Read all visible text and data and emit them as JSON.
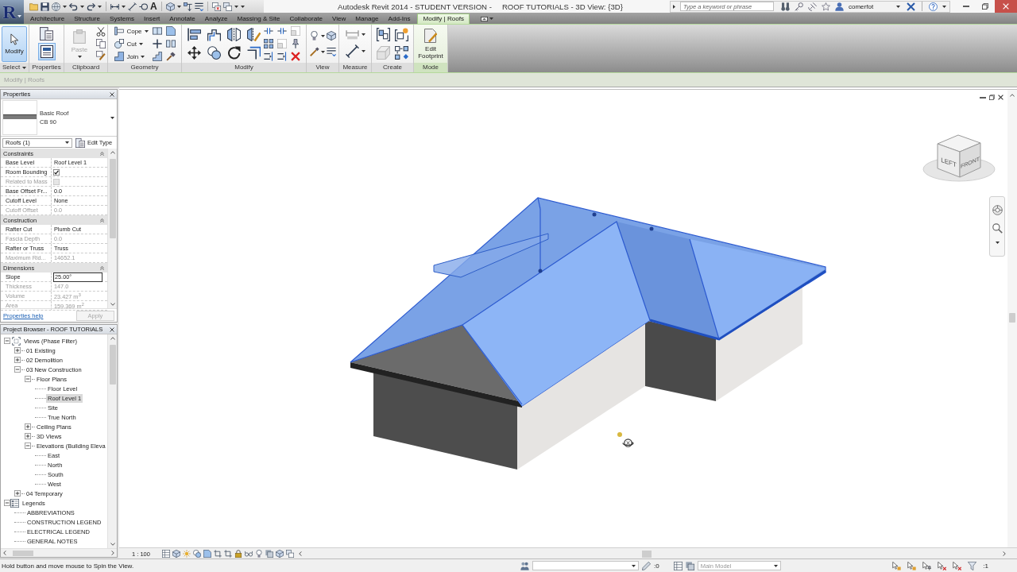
{
  "app": {
    "logo": "R",
    "title_left": "Autodesk Revit 2014 - STUDENT VERSION -",
    "title_right": "ROOF TUTORIALS - 3D View: {3D}"
  },
  "quick_access": {
    "text_tool": "A"
  },
  "infocenter": {
    "search": {
      "placeholder": "Type a keyword or phrase"
    },
    "user": "comerfot"
  },
  "tabs": [
    {
      "label": "Architecture",
      "selected": false
    },
    {
      "label": "Structure",
      "selected": false
    },
    {
      "label": "Systems",
      "selected": false
    },
    {
      "label": "Insert",
      "selected": false
    },
    {
      "label": "Annotate",
      "selected": false
    },
    {
      "label": "Analyze",
      "selected": false
    },
    {
      "label": "Massing & Site",
      "selected": false
    },
    {
      "label": "Collaborate",
      "selected": false
    },
    {
      "label": "View",
      "selected": false
    },
    {
      "label": "Manage",
      "selected": false
    },
    {
      "label": "Add-Ins",
      "selected": false
    },
    {
      "label": "Modify | Roofs",
      "selected": true
    }
  ],
  "ribbon": {
    "panels": [
      {
        "kind": "select",
        "label": "Select",
        "tools": [
          {
            "label": "Modify",
            "selected": true
          }
        ]
      },
      {
        "kind": "properties",
        "label": "Properties",
        "palette_on": true
      },
      {
        "kind": "clipboard",
        "label": "Clipboard",
        "tools": [
          {
            "label": "Paste",
            "disabled": true
          }
        ]
      },
      {
        "kind": "geometry",
        "label": "Geometry",
        "tools": [
          {
            "label": "Cope"
          },
          {
            "label": "Cut"
          },
          {
            "label": "Join"
          }
        ]
      },
      {
        "kind": "modify",
        "label": "Modify"
      },
      {
        "kind": "view",
        "label": "View"
      },
      {
        "kind": "measure",
        "label": "Measure"
      },
      {
        "kind": "create",
        "label": "Create"
      },
      {
        "kind": "mode",
        "label": "Mode",
        "tools": [
          {
            "label": "Edit Footprint"
          }
        ]
      }
    ]
  },
  "options_bar": {
    "context": "Modify | Roofs"
  },
  "properties": {
    "title": "Properties",
    "type_family": "Basic Roof",
    "type_name": "CB 90",
    "selector": "Roofs (1)",
    "edit_type": "Edit Type",
    "groups": [
      {
        "name": "Constraints",
        "expanded": true,
        "rows": [
          {
            "name": "Base Level",
            "kind": "text",
            "value": "Roof Level 1",
            "disabled": false
          },
          {
            "name": "Room Bounding",
            "kind": "checkbox",
            "checked": true,
            "disabled": false
          },
          {
            "name": "Related to Mass",
            "kind": "checkbox",
            "checked": false,
            "disabled": true
          },
          {
            "name": "Base Offset Fr...",
            "kind": "text",
            "value": "0.0",
            "disabled": false
          },
          {
            "name": "Cutoff Level",
            "kind": "text",
            "value": "None",
            "disabled": false
          },
          {
            "name": "Cutoff Offset",
            "kind": "text",
            "value": "0.0",
            "disabled": true
          }
        ]
      },
      {
        "name": "Construction",
        "expanded": true,
        "rows": [
          {
            "name": "Rafter Cut",
            "kind": "text",
            "value": "Plumb Cut",
            "disabled": false
          },
          {
            "name": "Fascia Depth",
            "kind": "text",
            "value": "0.0",
            "disabled": true
          },
          {
            "name": "Rafter or Truss",
            "kind": "text",
            "value": "Truss",
            "disabled": false
          },
          {
            "name": "Maximum Rid...",
            "kind": "text",
            "value": "14652.1",
            "disabled": true
          }
        ]
      },
      {
        "name": "Dimensions",
        "expanded": true,
        "rows": [
          {
            "name": "Slope",
            "kind": "input",
            "value": "25.00°",
            "disabled": false
          },
          {
            "name": "Thickness",
            "kind": "text",
            "value": "147.0",
            "disabled": true
          },
          {
            "name": "Volume",
            "kind": "text",
            "value": "23.427 m$^{3}$",
            "disabled": true
          },
          {
            "name": "Area",
            "kind": "text",
            "value": "159.369 m$^{2}$",
            "disabled": true
          }
        ]
      }
    ],
    "help_link": "Properties help",
    "apply": {
      "label": "Apply",
      "disabled": true
    }
  },
  "browser": {
    "title": "Project Browser - ROOF TUTORIALS",
    "tree": [
      {
        "label": "Views (Phase Filter)",
        "kind": "views",
        "expanded": true,
        "selected": false,
        "children": [
          {
            "label": "01 Existing",
            "expanded": false,
            "selected": false
          },
          {
            "label": "02 Demolition",
            "expanded": false,
            "selected": false
          },
          {
            "label": "03 New Construction",
            "expanded": true,
            "selected": false,
            "children": [
              {
                "label": "Floor Plans",
                "expanded": true,
                "selected": false,
                "children": [
                  {
                    "label": "Floor Level",
                    "selected": false
                  },
                  {
                    "label": "Roof Level 1",
                    "selected": true
                  },
                  {
                    "label": "Site",
                    "selected": false
                  },
                  {
                    "label": "True North",
                    "selected": false
                  }
                ]
              },
              {
                "label": "Ceiling Plans",
                "expanded": false,
                "selected": false
              },
              {
                "label": "3D Views",
                "expanded": false,
                "selected": false
              },
              {
                "label": "Elevations (Building Eleva",
                "expanded": true,
                "selected": false,
                "children": [
                  {
                    "label": "East",
                    "selected": false
                  },
                  {
                    "label": "North",
                    "selected": false
                  },
                  {
                    "label": "South",
                    "selected": false
                  },
                  {
                    "label": "West",
                    "selected": false
                  }
                ]
              }
            ]
          },
          {
            "label": "04 Temporary",
            "expanded": false,
            "selected": false
          }
        ]
      },
      {
        "label": "Legends",
        "kind": "legends",
        "expanded": true,
        "selected": false,
        "children": [
          {
            "label": "ABBREVIATIONS",
            "selected": false
          },
          {
            "label": "CONSTRUCTION LEGEND",
            "selected": false
          },
          {
            "label": "ELECTRICAL LEGEND",
            "selected": false
          },
          {
            "label": "GENERAL NOTES",
            "selected": false
          }
        ]
      }
    ]
  },
  "view": {
    "scale": "1 : 100",
    "viewcube_faces": [
      "LEFT",
      "FRONT"
    ]
  },
  "status_bar": {
    "hint": "Hold button and move mouse to Spin the View.",
    "editable_count": ":0",
    "design_option": "Main Model",
    "filter_count": ":1"
  }
}
